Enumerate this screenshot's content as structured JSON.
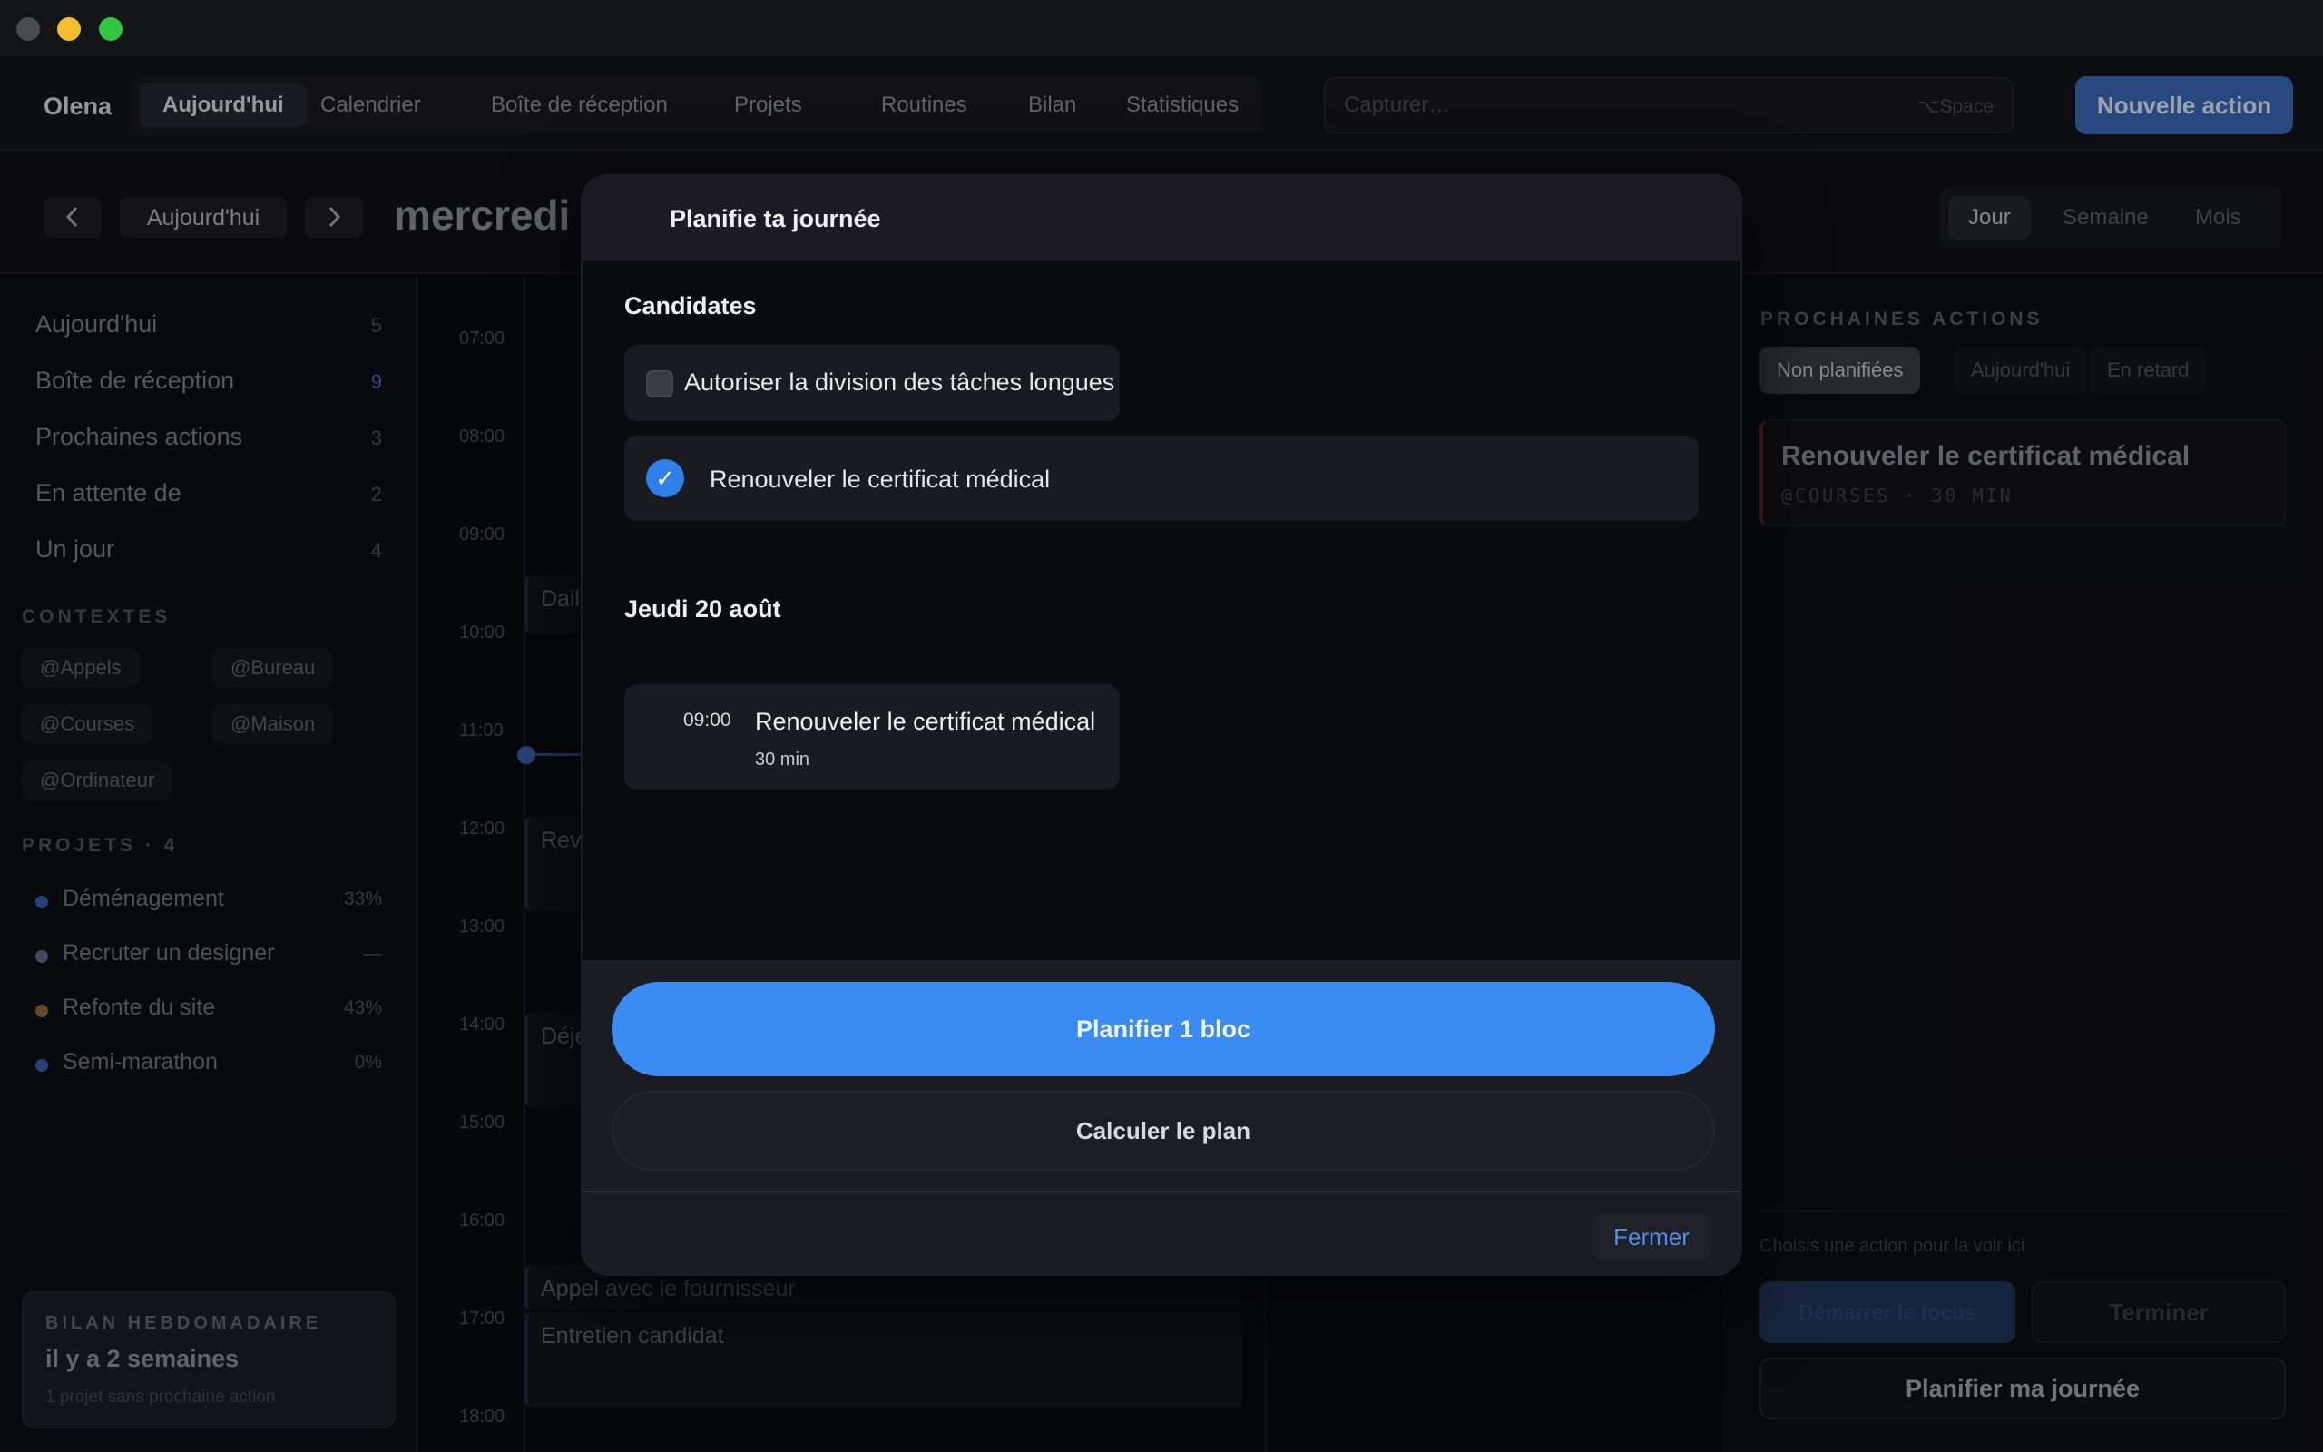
{
  "app": {
    "user_name": "Olena"
  },
  "nav": {
    "tabs": [
      {
        "label": "Aujourd'hui",
        "active": true
      },
      {
        "label": "Calendrier"
      },
      {
        "label": "Boîte de réception"
      },
      {
        "label": "Projets"
      },
      {
        "label": "Routines"
      },
      {
        "label": "Bilan"
      },
      {
        "label": "Statistiques"
      }
    ]
  },
  "capture": {
    "placeholder": "Capturer…",
    "shortcut": "⌥Space"
  },
  "new_action_label": "Nouvelle action",
  "datebar": {
    "today_label": "Aujourd'hui",
    "prev_icon": "chevron-left-icon",
    "next_icon": "chevron-right-icon",
    "date_title": "mercredi 1",
    "views": [
      {
        "label": "Jour",
        "active": true
      },
      {
        "label": "Semaine"
      },
      {
        "label": "Mois"
      }
    ]
  },
  "sidebar": {
    "items": [
      {
        "label": "Aujourd'hui",
        "count": "5"
      },
      {
        "label": "Boîte de réception",
        "count": "9",
        "highlight": true
      },
      {
        "label": "Prochaines actions",
        "count": "3"
      },
      {
        "label": "En attente de",
        "count": "2"
      },
      {
        "label": "Un jour",
        "count": "4"
      }
    ],
    "contexts_title": "CONTEXTES",
    "contexts": [
      "@Appels",
      "@Bureau",
      "@Courses",
      "@Maison",
      "@Ordinateur"
    ],
    "projects_title": "PROJETS · 4",
    "projects": [
      {
        "name": "Déménagement",
        "pct": "33%",
        "color": "#3a5fae"
      },
      {
        "name": "Recruter un designer",
        "pct": "—",
        "color": "#6b6588"
      },
      {
        "name": "Refonte du site",
        "pct": "43%",
        "color": "#8a6a3e"
      },
      {
        "name": "Semi-marathon",
        "pct": "0%",
        "color": "#3a5fae"
      }
    ],
    "weekly": {
      "title": "BILAN HEBDOMADAIRE",
      "value": "il y a 2 semaines",
      "sub": "1 projet sans prochaine action"
    }
  },
  "calendar": {
    "hours": [
      "07:00",
      "08:00",
      "09:00",
      "10:00",
      "11:00",
      "12:00",
      "13:00",
      "14:00",
      "15:00",
      "16:00",
      "17:00",
      "18:00"
    ],
    "events": [
      {
        "title": "Dail"
      },
      {
        "title": "Rev"
      },
      {
        "title": "Déje"
      },
      {
        "title": "Appel avec le fournisseur"
      },
      {
        "title": "Entretien candidat"
      }
    ]
  },
  "right_panel": {
    "title": "PROCHAINES ACTIONS",
    "tabs": [
      {
        "label": "Non planifiées",
        "active": true
      },
      {
        "label": "Aujourd'hui"
      },
      {
        "label": "En retard"
      }
    ],
    "card": {
      "title": "Renouveler le certificat médical",
      "meta": "@COURSES · 30 MIN"
    },
    "hint": "Choisis une action pour la voir ici",
    "start_label": "Démarrer le focus",
    "done_label": "Terminer",
    "plan_label": "Planifier ma journée"
  },
  "modal": {
    "title": "Planifie ta journée",
    "candidates_title": "Candidates",
    "split_label": "Autoriser la division des tâches longues",
    "candidate": {
      "label": "Renouveler le certificat médical",
      "checked": true
    },
    "day_title": "Jeudi 20 août",
    "block": {
      "time": "09:00",
      "title": "Renouveler le certificat médical",
      "duration": "30 min"
    },
    "primary_label": "Planifier 1 bloc",
    "secondary_label": "Calculer le plan",
    "close_label": "Fermer"
  },
  "colors": {
    "accent": "#3a8bf2",
    "brand_button": "#3a67b8",
    "background": "#0b0c10"
  }
}
